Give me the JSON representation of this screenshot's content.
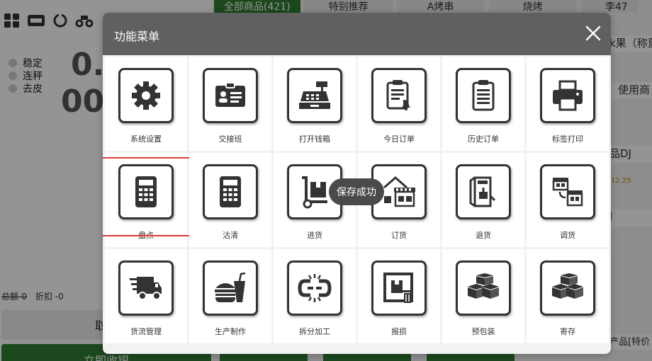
{
  "background": {
    "scale_status": [
      "稳定",
      "连秤",
      "去皮"
    ],
    "weight_line1": "0.",
    "weight_line2": "00",
    "summary": {
      "total": "总额-0",
      "discount": "折扣 -0"
    },
    "cancel_label": "取单",
    "pay_label": "立即收银",
    "category_tabs": [
      "全部商品(421)",
      "特别推荐",
      "A烤串",
      "烧烤",
      "李47"
    ],
    "right_items": [
      "k果（称重",
      "使用商",
      "品DJ",
      "J",
      "产品[特价"
    ],
    "right_price": "12.25"
  },
  "modal": {
    "title": "功能菜单",
    "tiles": [
      {
        "label": "系统设置",
        "icon": "gear-icon"
      },
      {
        "label": "交接班",
        "icon": "id-card-icon"
      },
      {
        "label": "打开钱箱",
        "icon": "cash-register-icon"
      },
      {
        "label": "今日订单",
        "icon": "clipboard-bell-icon"
      },
      {
        "label": "历史订单",
        "icon": "clipboard-list-icon"
      },
      {
        "label": "标签打印",
        "icon": "printer-icon"
      },
      {
        "label": "盘点",
        "icon": "calculator-icon"
      },
      {
        "label": "沽清",
        "icon": "calculator-icon"
      },
      {
        "label": "进货",
        "icon": "hand-truck-icon"
      },
      {
        "label": "订货",
        "icon": "store-boxes-icon"
      },
      {
        "label": "退货",
        "icon": "exit-door-icon"
      },
      {
        "label": "调货",
        "icon": "transfer-stores-icon"
      },
      {
        "label": "货流管理",
        "icon": "delivery-truck-icon"
      },
      {
        "label": "生产制作",
        "icon": "burger-drink-icon"
      },
      {
        "label": "拆分加工",
        "icon": "broken-link-icon"
      },
      {
        "label": "报损",
        "icon": "damaged-box-trash-icon"
      },
      {
        "label": "预包装",
        "icon": "box-stack-icon"
      },
      {
        "label": "寄存",
        "icon": "box-stack-icon"
      }
    ],
    "selected_tile": "盘点"
  },
  "toast": "保存成功",
  "colors": {
    "accent": "#2f7d32",
    "highlight": "#e23b32",
    "header": "#606060"
  }
}
